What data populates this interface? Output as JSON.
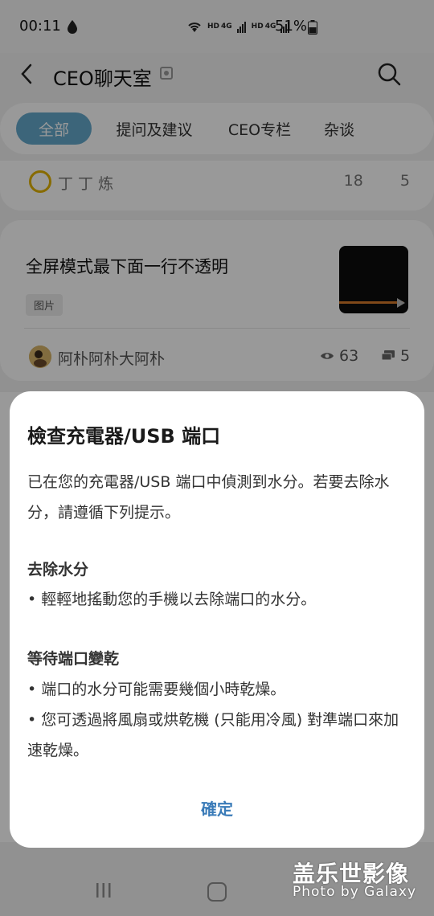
{
  "status_bar": {
    "time": "00:11",
    "battery": "51%",
    "network_label_1": "HD",
    "network_label_2": "4G",
    "network_label_3": "HD",
    "network_label_4": "4G"
  },
  "header": {
    "title": "CEO聊天室"
  },
  "tabs": [
    {
      "label": "全部",
      "active": true
    },
    {
      "label": "提问及建议",
      "active": false
    },
    {
      "label": "CEO专栏",
      "active": false
    },
    {
      "label": "杂谈",
      "active": false
    }
  ],
  "feed": {
    "partial_card": {
      "author": "丁 丁 炼",
      "views": "18",
      "comments": "5"
    },
    "post": {
      "title": "全屏模式最下面一行不透明",
      "tag": "图片",
      "author": "阿朴阿朴大阿朴",
      "views": "63",
      "comments": "5"
    }
  },
  "dialog": {
    "title": "檢查充電器/USB 端口",
    "body": "已在您的充電器/USB 端口中偵測到水分。若要去除水分，請遵循下列提示。",
    "section1_title": "去除水分",
    "section1_bullet1": "• 輕輕地搖動您的手機以去除端口的水分。",
    "section2_title": "等待端口變乾",
    "section2_bullet1": "• 端口的水分可能需要幾個小時乾燥。",
    "section2_bullet2": "• 您可透過將風扇或烘乾機 (只能用冷風) 對準端口來加速乾燥。",
    "confirm_label": "確定"
  },
  "watermark": {
    "title": "盖乐世影像",
    "subtitle": "Photo by Galaxy"
  },
  "colors": {
    "accent_tab": "#64a9cc",
    "confirm_text": "#3a7bb8",
    "overlay": "rgba(0,0,0,0.40)"
  }
}
